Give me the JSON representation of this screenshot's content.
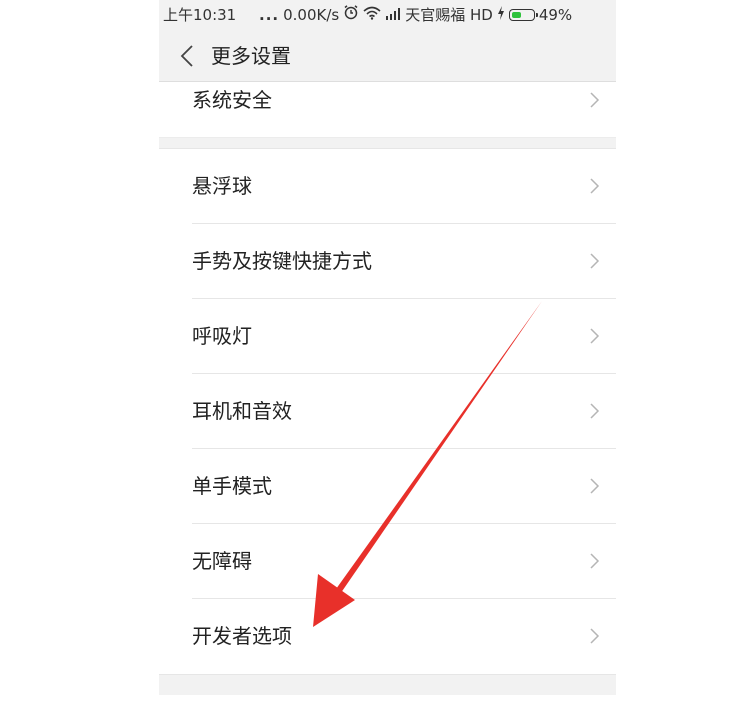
{
  "status_bar": {
    "time": "上午10:31",
    "dots": "...",
    "speed": "0.00K/s",
    "carrier": "天官赐福 HD",
    "battery_percent": "49%",
    "battery_level": 0.49,
    "battery_color": "#2ec23c"
  },
  "header": {
    "title": "更多设置"
  },
  "settings": {
    "items": [
      {
        "label": "系统安全"
      },
      {
        "label": "悬浮球"
      },
      {
        "label": "手势及按键快捷方式"
      },
      {
        "label": "呼吸灯"
      },
      {
        "label": "耳机和音效"
      },
      {
        "label": "单手模式"
      },
      {
        "label": "无障碍"
      },
      {
        "label": "开发者选项"
      }
    ]
  },
  "annotation": {
    "arrow_color": "#e8302a"
  }
}
